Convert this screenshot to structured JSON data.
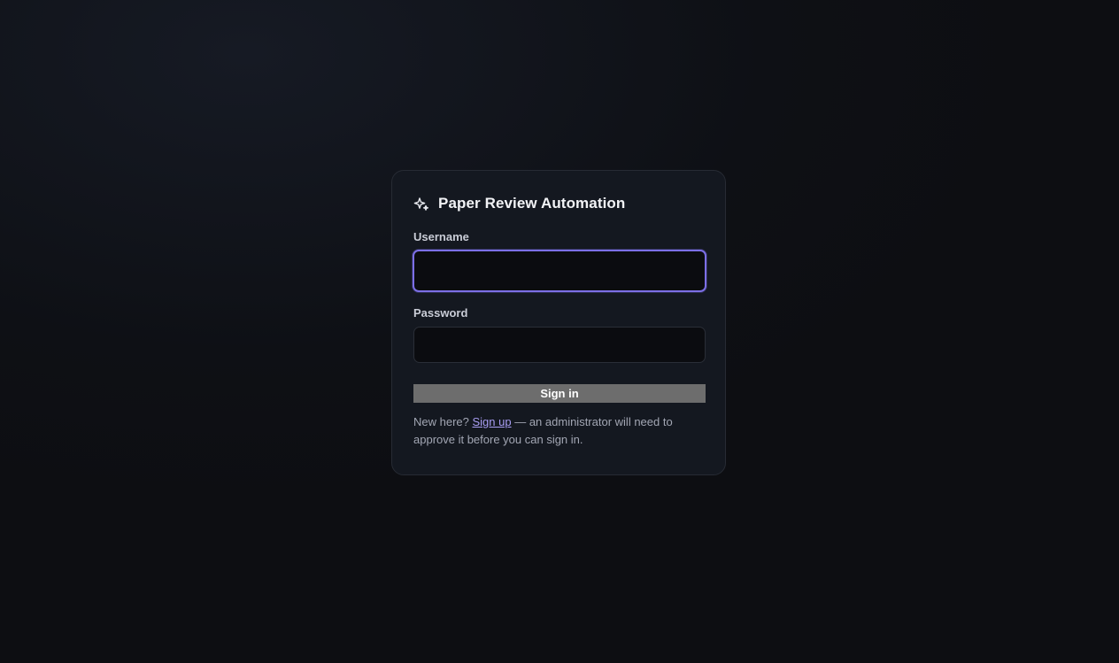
{
  "app": {
    "title": "Paper Review Automation",
    "icon": "sparkle-icon"
  },
  "form": {
    "username": {
      "label": "Username",
      "value": "",
      "placeholder": ""
    },
    "password": {
      "label": "Password",
      "value": "",
      "placeholder": ""
    },
    "submit_label": "Sign in"
  },
  "footer": {
    "prefix": "New here?",
    "link_label": "Sign up",
    "suffix": "— an administrator will need to approve it before you can sign in."
  },
  "colors": {
    "background": "#0e1015",
    "card": "#141820",
    "accent": "#7c6fe6",
    "link": "#a89df2",
    "button": "#6d6d6d"
  }
}
